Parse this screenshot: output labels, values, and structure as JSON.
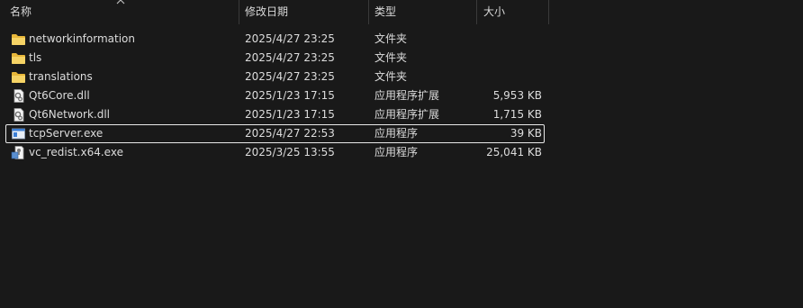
{
  "columns": {
    "name": "名称",
    "date": "修改日期",
    "type": "类型",
    "size": "大小"
  },
  "files": [
    {
      "name": "networkinformation",
      "date": "2025/4/27 23:25",
      "type": "文件夹",
      "size": "",
      "icon": "folder-icon"
    },
    {
      "name": "tls",
      "date": "2025/4/27 23:25",
      "type": "文件夹",
      "size": "",
      "icon": "folder-icon"
    },
    {
      "name": "translations",
      "date": "2025/4/27 23:25",
      "type": "文件夹",
      "size": "",
      "icon": "folder-icon"
    },
    {
      "name": "Qt6Core.dll",
      "date": "2025/1/23 17:15",
      "type": "应用程序扩展",
      "size": "5,953 KB",
      "icon": "dll-icon"
    },
    {
      "name": "Qt6Network.dll",
      "date": "2025/1/23 17:15",
      "type": "应用程序扩展",
      "size": "1,715 KB",
      "icon": "dll-icon"
    },
    {
      "name": "tcpServer.exe",
      "date": "2025/4/27 22:53",
      "type": "应用程序",
      "size": "39 KB",
      "icon": "exe-icon"
    },
    {
      "name": "vc_redist.x64.exe",
      "date": "2025/3/25 13:55",
      "type": "应用程序",
      "size": "25,041 KB",
      "icon": "installer-icon"
    }
  ],
  "colors": {
    "background": "#191919",
    "folder": "#f2c94c",
    "focus_border": "#e8e8e8"
  }
}
